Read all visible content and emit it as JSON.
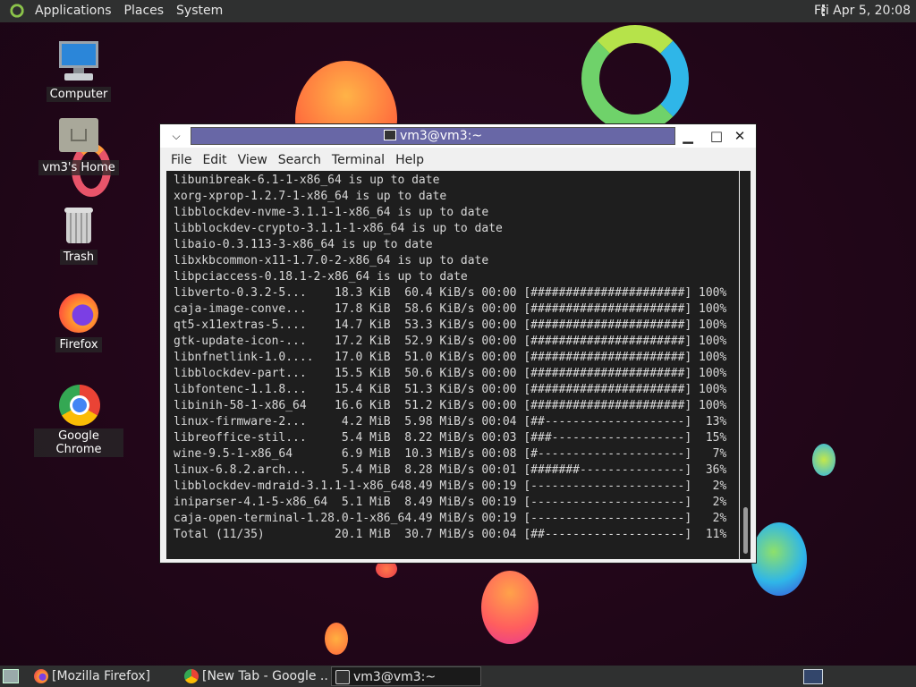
{
  "top_panel": {
    "menus": [
      "Applications",
      "Places",
      "System"
    ],
    "clock": "Fri Apr  5, 20:08"
  },
  "desktop_icons": [
    {
      "label": "Computer",
      "icon": "computer-icon"
    },
    {
      "label": "vm3's Home",
      "icon": "home-folder-icon"
    },
    {
      "label": "Trash",
      "icon": "trash-icon"
    },
    {
      "label": "Firefox",
      "icon": "firefox-icon"
    },
    {
      "label": "Google Chrome",
      "icon": "chrome-icon"
    }
  ],
  "terminal": {
    "title": "vm3@vm3:~",
    "menu": [
      "File",
      "Edit",
      "View",
      "Search",
      "Terminal",
      "Help"
    ],
    "lines": [
      "libunibreak-6.1-1-x86_64 is up to date",
      "xorg-xprop-1.2.7-1-x86_64 is up to date",
      "libblockdev-nvme-3.1.1-1-x86_64 is up to date",
      "libblockdev-crypto-3.1.1-1-x86_64 is up to date",
      "libaio-0.3.113-3-x86_64 is up to date",
      "libxkbcommon-x11-1.7.0-2-x86_64 is up to date",
      "libpciaccess-0.18.1-2-x86_64 is up to date",
      "libverto-0.3.2-5...    18.3 KiB  60.4 KiB/s 00:00 [######################] 100%",
      "caja-image-conve...    17.8 KiB  58.6 KiB/s 00:00 [######################] 100%",
      "qt5-x11extras-5....    14.7 KiB  53.3 KiB/s 00:00 [######################] 100%",
      "gtk-update-icon-...    17.2 KiB  52.9 KiB/s 00:00 [######################] 100%",
      "libnfnetlink-1.0....   17.0 KiB  51.0 KiB/s 00:00 [######################] 100%",
      "libblockdev-part...    15.5 KiB  50.6 KiB/s 00:00 [######################] 100%",
      "libfontenc-1.1.8...    15.4 KiB  51.3 KiB/s 00:00 [######################] 100%",
      "libinih-58-1-x86_64    16.6 KiB  51.2 KiB/s 00:00 [######################] 100%",
      "linux-firmware-2...     4.2 MiB  5.98 MiB/s 00:04 [##--------------------]  13%",
      "libreoffice-stil...     5.4 MiB  8.22 MiB/s 00:03 [###-------------------]  15%",
      "wine-9.5-1-x86_64       6.9 MiB  10.3 MiB/s 00:08 [#---------------------]   7%",
      "linux-6.8.2.arch...     5.4 MiB  8.28 MiB/s 00:01 [#######---------------]  36%",
      "libblockdev-mdraid-3.1.1-1-x86_648.49 MiB/s 00:19 [----------------------]   2%",
      "iniparser-4.1-5-x86_64  5.1 MiB  8.49 MiB/s 00:19 [----------------------]   2%",
      "caja-open-terminal-1.28.0-1-x86_64.49 MiB/s 00:19 [----------------------]   2%",
      "Total (11/35)          20.1 MiB  30.7 MiB/s 00:04 [##--------------------]  11%"
    ]
  },
  "taskbar": {
    "tasks": [
      {
        "label": "[Mozilla Firefox]",
        "icon": "firefox-icon"
      },
      {
        "label": "[New Tab - Google ...",
        "icon": "chrome-icon"
      },
      {
        "label": "vm3@vm3:~",
        "icon": "terminal-icon"
      }
    ]
  }
}
